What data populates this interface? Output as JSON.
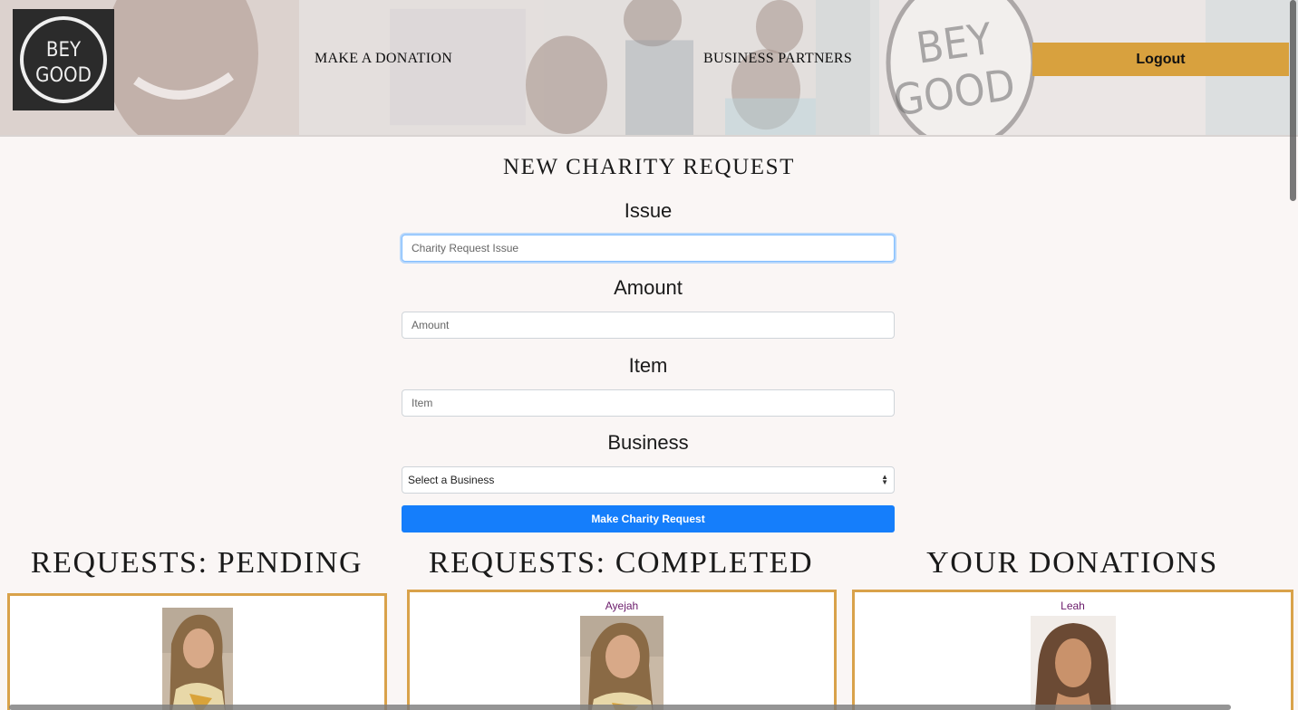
{
  "header": {
    "logo_text": [
      "BEY",
      "GOOD"
    ],
    "nav": {
      "donate": "MAKE A DONATION",
      "partners": "BUSINESS PARTNERS"
    },
    "logout_label": "Logout"
  },
  "form": {
    "title": "NEW CHARITY REQUEST",
    "issue_label": "Issue",
    "issue_placeholder": "Charity Request Issue",
    "amount_label": "Amount",
    "amount_placeholder": "Amount",
    "item_label": "Item",
    "item_placeholder": "Item",
    "business_label": "Business",
    "business_selected": "Select a Business",
    "submit_label": "Make Charity Request"
  },
  "columns": {
    "pending": {
      "heading": "REQUESTS: PENDING",
      "name": ""
    },
    "completed": {
      "heading": "REQUESTS: COMPLETED",
      "name": "Ayejah"
    },
    "donations": {
      "heading": "YOUR DONATIONS",
      "name": "Leah"
    }
  },
  "colors": {
    "accent": "#d8a13e",
    "primary_button": "#157efb",
    "card_border": "#d9a24a",
    "name_text": "#6a1b6a"
  }
}
